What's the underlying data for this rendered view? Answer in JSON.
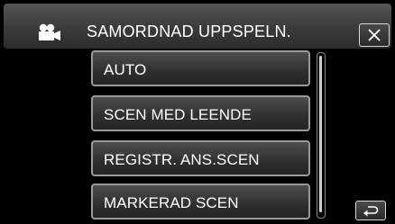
{
  "header": {
    "title": "SAMORDNAD UPPSPELN.",
    "mode_icon": "movie-camera-icon",
    "close_icon": "close-icon"
  },
  "menu": {
    "items": [
      {
        "label": "AUTO"
      },
      {
        "label": "SCEN MED LEENDE"
      },
      {
        "label": "REGISTR. ANS.SCEN"
      },
      {
        "label": "MARKERAD SCEN"
      }
    ]
  },
  "footer": {
    "back_icon": "return-arrow-icon"
  },
  "colors": {
    "background": "#000000",
    "button_border": "#9a9a9a",
    "text": "#ffffff"
  }
}
